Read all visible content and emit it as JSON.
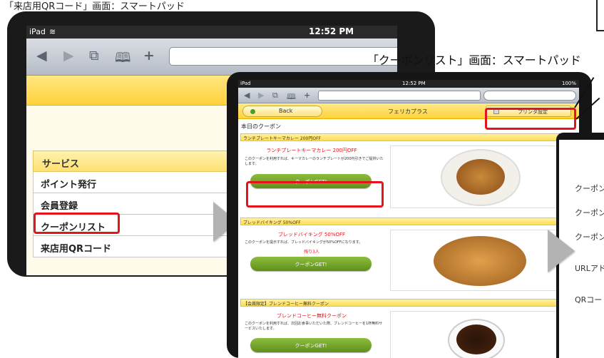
{
  "captions": {
    "top_left": "「来店用QRコード」画面：スマートパッド",
    "right": "「クーポンリスト」画面：スマートパッド"
  },
  "tablet1": {
    "status": {
      "carrier": "iPad",
      "time": "12:52 PM"
    },
    "menu": {
      "header": "サービス",
      "items": [
        {
          "label": "ポイント発行"
        },
        {
          "label": "会員登録"
        },
        {
          "label": "クーポンリスト"
        },
        {
          "label": "来店用QRコード"
        }
      ]
    }
  },
  "tablet2": {
    "status": {
      "carrier": "iPad",
      "time": "12:52 PM",
      "battery": "100%"
    },
    "header": {
      "back": "Back",
      "title": "フェリカプラス",
      "printer": "プリンタ設定"
    },
    "today": "本日のクーポン",
    "coupons": [
      {
        "bar": "ランチプレートキーマカレー 200円OFF",
        "title": "ランチプレートキーマカレー 200円OFF",
        "desc": "このクーポンを利用すれば、キーマカレーのランチプレートが200円引きでご提供いたします。",
        "remain": "",
        "button": "クーポンGET!"
      },
      {
        "bar": "ブレッドバイキング 50%OFF",
        "title": "ブレッドバイキング 50%OFF",
        "desc": "このクーポンを提示すれば、ブレッドバイキングが50%OFFになります。",
        "remain": "残り3人",
        "button": "クーポンGET!"
      },
      {
        "bar": "【会員限定】ブレンドコーヒー無料クーポン",
        "title": "ブレンドコーヒー無料クーポン",
        "desc": "このクーポンを利用すれば、次回お食事いただいた際、ブレンドコーヒーを1杯無料サービスいたします。",
        "remain": "",
        "button": "クーポンGET!"
      }
    ]
  },
  "tablet3": {
    "rows": [
      "クーポン",
      "クーポン",
      "クーポン",
      "URLアド",
      "QRコー"
    ]
  }
}
